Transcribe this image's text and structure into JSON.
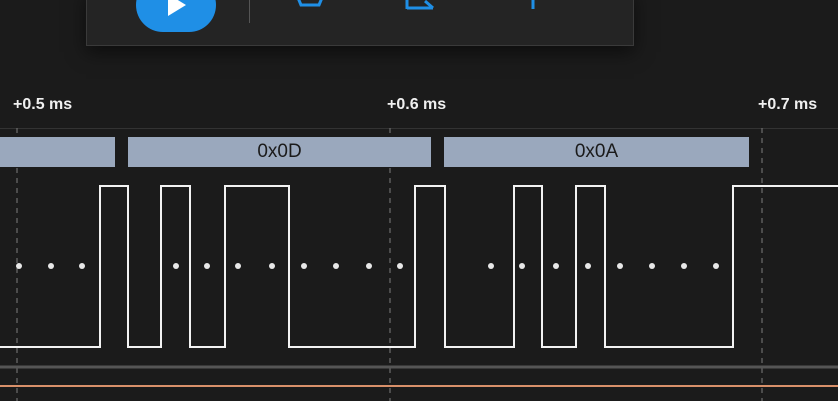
{
  "toolbar": {
    "play_icon": "play-icon",
    "icons": [
      "hexagon-icon",
      "measure-icon",
      "marker-icon"
    ],
    "accent_color": "#1f8fe6"
  },
  "timeline": {
    "labels": [
      "+0.5 ms",
      "+0.6 ms",
      "+0.7 ms"
    ]
  },
  "decoder": {
    "frames": [
      "",
      "0x0D",
      "0x0A"
    ],
    "frame_color": "#9aa8bd"
  },
  "signal": {
    "line_color": "#f2f2f2",
    "channel_color": "#d8906a"
  }
}
